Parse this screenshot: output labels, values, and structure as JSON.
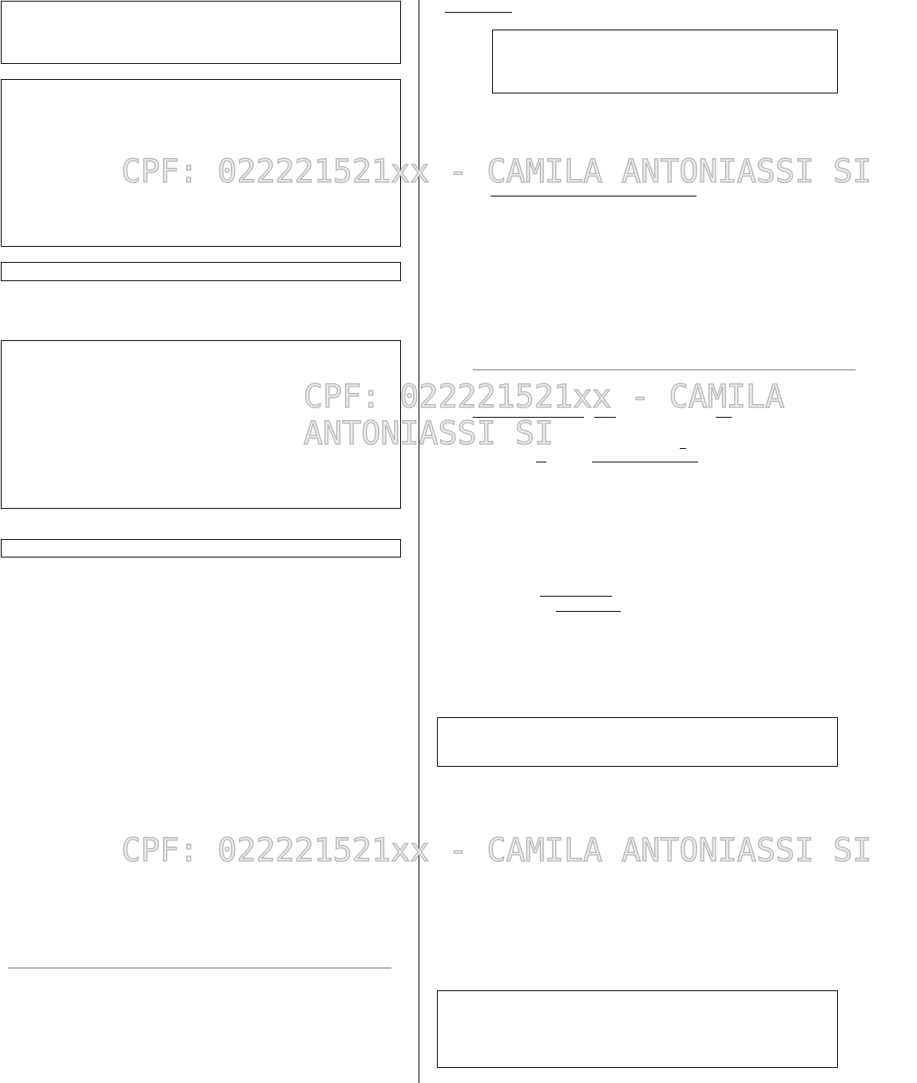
{
  "watermark": {
    "text": "CPF: 022221521xx - CAMILA ANTONIASSI SI",
    "color": "#b4b4b4"
  },
  "rule_color": "#b8b6a6"
}
